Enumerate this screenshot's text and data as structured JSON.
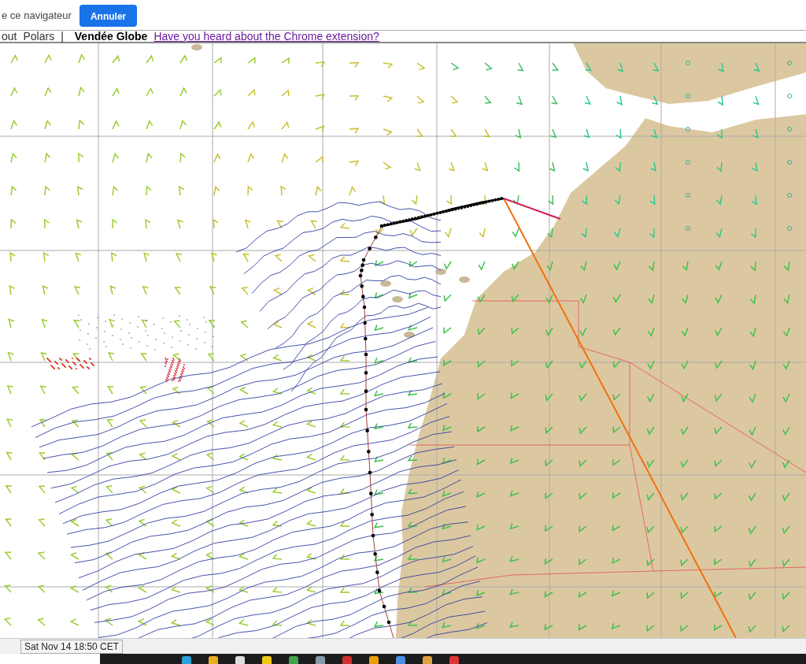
{
  "notice": {
    "text": "e ce navigateur",
    "button": "Annuler"
  },
  "menu": {
    "items": [
      "out",
      "Polars"
    ],
    "separator": "|",
    "title": "Vendée Globe",
    "link": "Have you heard about the Chrome extension?"
  },
  "status_bar": {
    "time": "Sat Nov 14 18:50 CET"
  }
}
